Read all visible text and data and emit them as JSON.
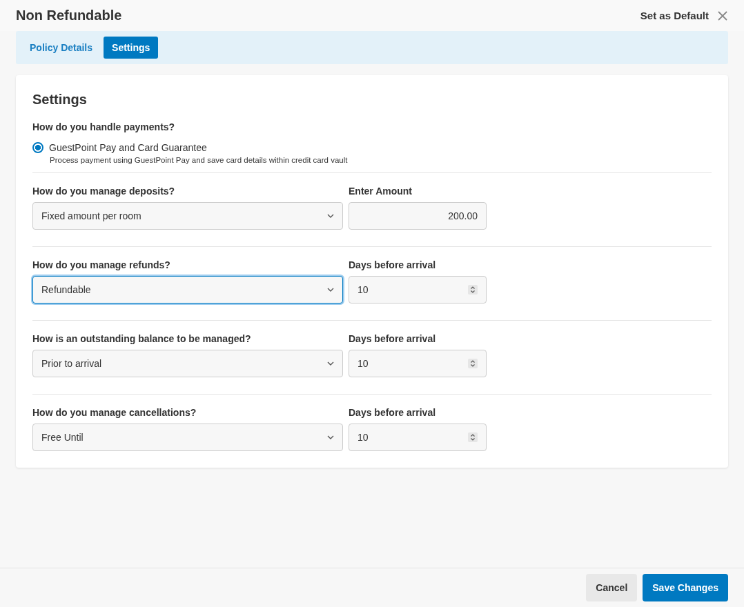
{
  "header": {
    "title": "Non Refundable",
    "default_link": "Set as Default"
  },
  "tabs": [
    {
      "label": "Policy Details",
      "selected": false
    },
    {
      "label": "Settings",
      "selected": true
    }
  ],
  "card": {
    "title": "Settings",
    "payments": {
      "question": "How do you handle payments?",
      "options": [
        {
          "label": "GuestPoint Pay and Card Guarantee",
          "description": "Process payment using GuestPoint Pay and save card details within credit card vault",
          "selected": true
        }
      ]
    },
    "rows": [
      {
        "question": "How do you manage deposits?",
        "select_value": "Fixed amount per room",
        "focused": false,
        "field_label": "Enter Amount",
        "kind": "amount",
        "field_value": "200.00"
      },
      {
        "question": "How do you manage refunds?",
        "select_value": "Refundable",
        "focused": true,
        "field_label": "Days before arrival",
        "kind": "number",
        "field_value": "10"
      },
      {
        "question": "How is an outstanding balance to be managed?",
        "select_value": "Prior to arrival",
        "focused": false,
        "field_label": "Days before arrival",
        "kind": "number",
        "field_value": "10"
      },
      {
        "question": "How do you manage cancellations?",
        "select_value": "Free Until",
        "focused": false,
        "field_label": "Days before arrival",
        "kind": "number",
        "field_value": "10"
      }
    ]
  },
  "footer": {
    "buttons": [
      {
        "label": "Cancel",
        "kind": "secondary"
      },
      {
        "label": "Save Changes",
        "kind": "primary"
      }
    ]
  }
}
